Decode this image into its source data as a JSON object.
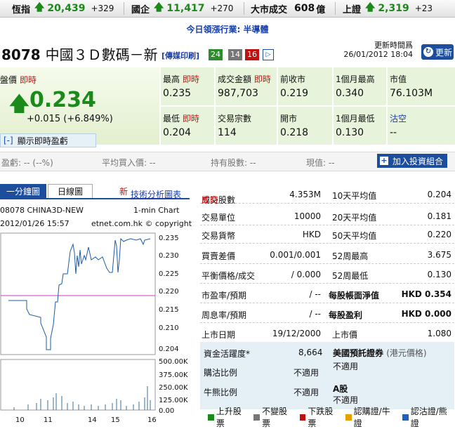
{
  "ticker": [
    {
      "label": "恆指",
      "value": "20,439",
      "change": "+329"
    },
    {
      "label": "國企",
      "value": "11,417",
      "change": "+270"
    },
    {
      "label": "大市成交",
      "value": "608",
      "unit": "億"
    },
    {
      "label": "上證",
      "value": "2,319",
      "change": "+23"
    }
  ],
  "hot_sector": "今日領漲行業: 半導體",
  "stock": {
    "code": "8078",
    "name": "中國３Ｄ數碼－新",
    "tag": "[傳媒印刷]",
    "boxes": [
      "24",
      "14",
      "16"
    ],
    "update_label": "更新時間爲",
    "update_time": "26/01/2012 18:04",
    "refresh_label": "更新"
  },
  "quote": {
    "price_label": "盤價",
    "realtime": "即時",
    "price": "0.234",
    "change": "+0.015 (+6.849%)",
    "show_button": "顯示即時盈虧",
    "high_label": "最高",
    "high": "0.235",
    "low_label": "最低",
    "low": "0.204",
    "turnover_label": "成交金額",
    "turnover": "987,703",
    "trades_label": "交易宗數",
    "trades": "114",
    "prev_close_label": "前收市",
    "prev_close": "0.219",
    "open_label": "開市",
    "open": "0.218",
    "m1_high_label": "1個月最高",
    "m1_high": "0.340",
    "m1_low_label": "1個月最低",
    "m1_low": "0.130",
    "mktcap_label": "市值",
    "mktcap": "76.103M",
    "short_label": "沽空",
    "short": "--"
  },
  "holding": {
    "pnl": "盈虧: -- (--%)",
    "avg_buy": "平均買入價: --",
    "shares": "持有股數: --",
    "current": "現值: --",
    "add_button": "加入投資組合"
  },
  "chart": {
    "tab_minute": "一分鐘圖",
    "tab_daily": "日線圖",
    "new_label": "新",
    "tech_link": "技術分析圖表",
    "symbol": "08078 CHINA3D-NEW",
    "chart_type": "1-min Chart",
    "date": "2012/01/26 15:57",
    "source": "etnet.com.hk © copyright",
    "price_ticks": [
      "0.235",
      "0.230",
      "0.225",
      "0.220",
      "0.215",
      "0.210",
      "0.204"
    ],
    "vol_ticks": [
      "500.00K",
      "375.00K",
      "250.00K",
      "125.00K",
      "0.00"
    ],
    "x_ticks": [
      "10",
      "11",
      "14",
      "15",
      "16"
    ]
  },
  "stats": [
    {
      "l1": "成交股數",
      "l1_red": "即時",
      "v1": "4.353M",
      "l2": "10天平均值",
      "v2": "0.204"
    },
    {
      "l1": "交易單位",
      "v1": "10000",
      "l2": "20天平均值",
      "v2": "0.181"
    },
    {
      "l1": "交易貨幣",
      "v1": "HKD",
      "l2": "50天平均值",
      "v2": "0.220"
    },
    {
      "l1": "買賣差價",
      "v1": "0.001/0.001",
      "l2": "52周最高",
      "v2": "3.675"
    },
    {
      "l1": "平衡價格/成交",
      "v1": "/ 0.000",
      "l2": "52周最低",
      "v2": "0.130"
    },
    {
      "l1": "市盈率/預期",
      "v1": "/ --",
      "l2": "每股帳面淨值",
      "v2": "HKD 0.354"
    },
    {
      "l1": "周息率/預期",
      "v1": "/ --",
      "l2": "每股盈利",
      "v2": "HKD 0.000"
    },
    {
      "l1": "上市日期",
      "v1": "19/12/2000",
      "l2": "上市價",
      "v2": "1.080"
    }
  ],
  "extra": {
    "active_label": "資金活躍度*",
    "active": "8,664",
    "call_label": "購沽比例",
    "call": "不適用",
    "bull_label": "牛熊比例",
    "bull": "不適用",
    "warrant_label": "美國預託證券",
    "warrant_sub": "(港元價格)",
    "warrant": "不適用",
    "a_label": "A股",
    "a": "不適用"
  },
  "legend": [
    "上升股票",
    "不變股票",
    "下跌股票",
    "認購證/牛證",
    "認沽證/熊證"
  ],
  "colors": {
    "up": "#1a8a1a",
    "red": "#d01010",
    "blue": "#1d4e9e",
    "legend": [
      "#1a8a1a",
      "#777777",
      "#c01010",
      "#e6a000",
      "#2060c0"
    ]
  }
}
